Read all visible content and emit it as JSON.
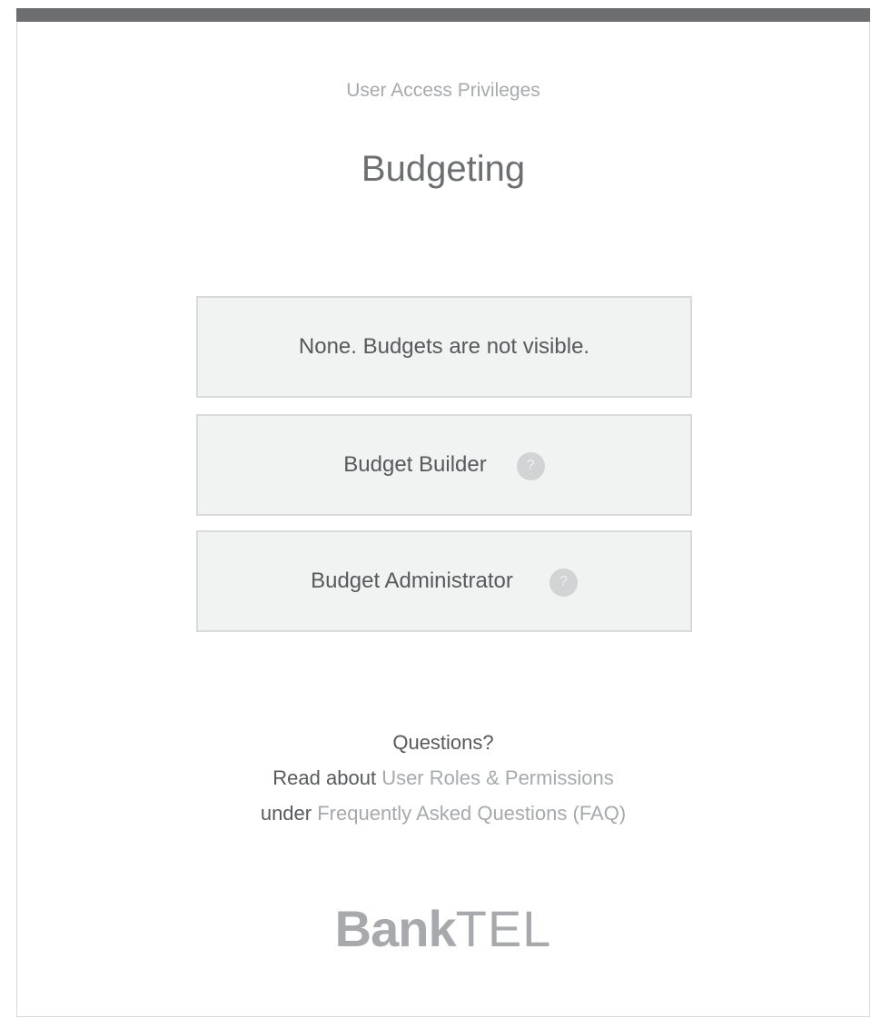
{
  "header": {
    "subtitle": "User Access Privileges",
    "title": "Budgeting"
  },
  "options": [
    {
      "label": "None. Budgets are not visible.",
      "has_help": false
    },
    {
      "label": "Budget Builder",
      "has_help": true,
      "help_icon": "question-icon",
      "help_glyph": "?"
    },
    {
      "label": "Budget Administrator",
      "has_help": true,
      "help_icon": "question-icon",
      "help_glyph": "?"
    }
  ],
  "help": {
    "heading": "Questions?",
    "line2_prefix": "Read about",
    "line2_link": "User Roles & Permissions",
    "line3_prefix": "under",
    "line3_link": "Frequently Asked Questions (FAQ)"
  },
  "brand": {
    "bold": "Bank",
    "light": "TEL"
  },
  "colors": {
    "topbar": "#6d6e72",
    "title": "#6d6e72",
    "muted": "#a7a9ac",
    "option_bg": "#f1f2f2",
    "option_border": "#d9dadb",
    "help_icon_bg": "#d1d3d4"
  }
}
